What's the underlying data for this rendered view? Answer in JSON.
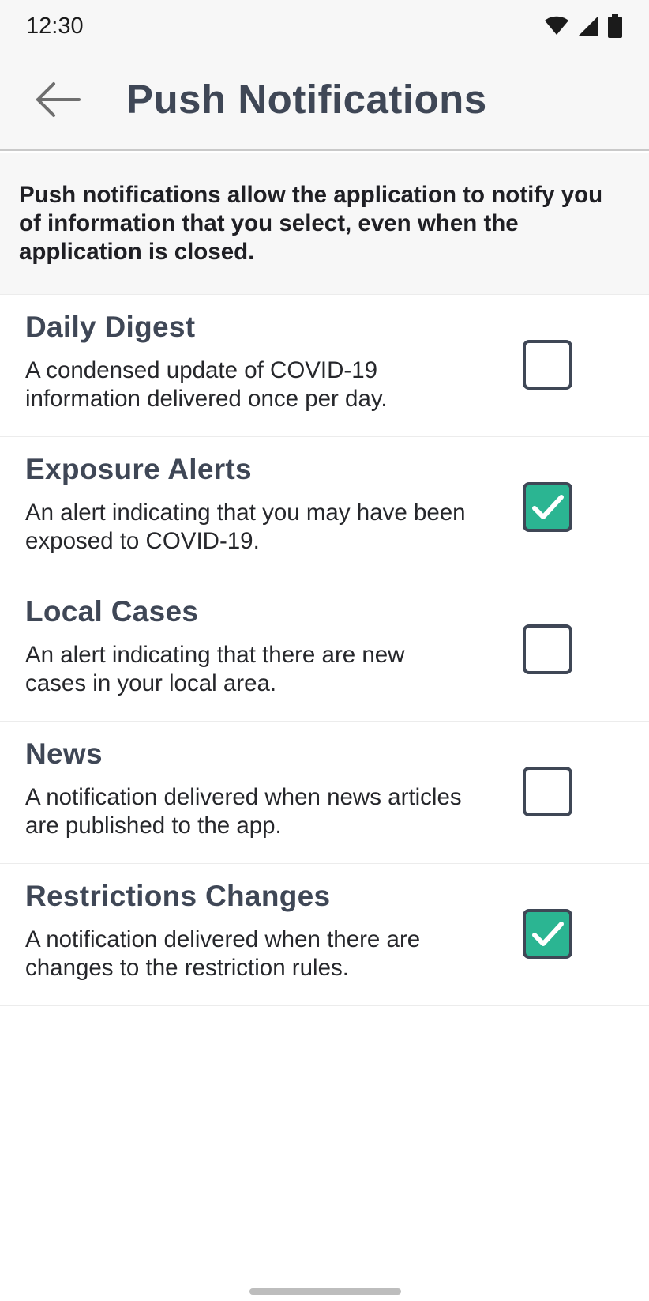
{
  "status_bar": {
    "time": "12:30",
    "icons": [
      "wifi-icon",
      "cellular-signal-icon",
      "battery-icon"
    ]
  },
  "app_bar": {
    "back_icon": "arrow-left-icon",
    "title": "Push Notifications"
  },
  "intro": {
    "text": "Push notifications allow the application to notify you of information that you select, even when the application is closed."
  },
  "options": [
    {
      "title": "Daily Digest",
      "description": "A condensed update of COVID-19 information delivered once per day.",
      "checked": false
    },
    {
      "title": "Exposure Alerts",
      "description": "An alert indicating that you may have been exposed to COVID-19.",
      "checked": true
    },
    {
      "title": "Local Cases",
      "description": "An alert indicating that there are new cases in your local area.",
      "checked": false
    },
    {
      "title": "News",
      "description": "A notification delivered when news articles are published to the app.",
      "checked": false
    },
    {
      "title": "Restrictions Changes",
      "description": "A notification delivered when there are changes to the restriction rules.",
      "checked": true
    }
  ],
  "colors": {
    "accent": "#2bb592",
    "text_primary": "#3f4756",
    "header_bg": "#f7f7f7"
  }
}
